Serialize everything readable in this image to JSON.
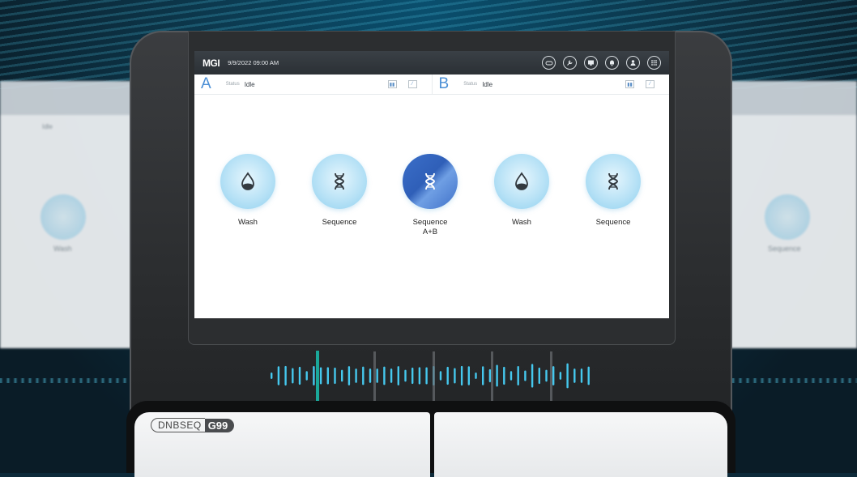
{
  "topbar": {
    "logo": "MGI",
    "datetime": "9/9/2022  09:00 AM",
    "icons": [
      "dump-icon",
      "wrench-icon",
      "monitor-icon",
      "bell-icon",
      "user-icon",
      "apps-grid-icon"
    ]
  },
  "modes": [
    {
      "letter": "A",
      "status_label": "Status",
      "status_value": "Idle"
    },
    {
      "letter": "B",
      "status_label": "Status",
      "status_value": "Idle"
    }
  ],
  "tiles": [
    {
      "label": "Wash",
      "icon": "water-drop-icon",
      "active": false
    },
    {
      "label": "Sequence",
      "icon": "dna-icon",
      "active": false
    },
    {
      "label": "Sequence\nA+B",
      "icon": "dna-icon",
      "active": true
    },
    {
      "label": "Wash",
      "icon": "water-drop-icon",
      "active": false
    },
    {
      "label": "Sequence",
      "icon": "dna-icon",
      "active": false
    }
  ],
  "side_ghosts": {
    "left_label": "Wash",
    "right_label": "Sequence",
    "left_status": "Idle"
  },
  "device": {
    "brand_prefix": "DNBSEQ",
    "brand_model": "G99"
  },
  "colors": {
    "accent": "#4b8fd6",
    "active_tile": "#3564bf",
    "waveform": "#45c8ee",
    "highlight_bar": "#1aa89a"
  }
}
